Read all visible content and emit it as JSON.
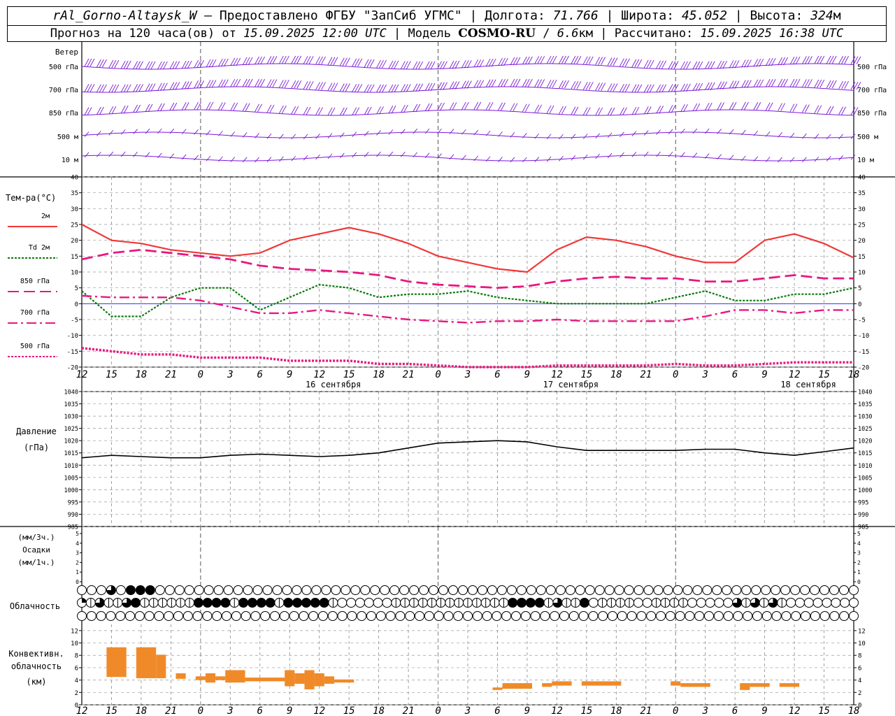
{
  "header": {
    "station": "rAl_Gorno-Altaysk_W",
    "provider": "– Предоставлено ФГБУ \"ЗапСиб УГМС\"",
    "lon_label": "Долгота:",
    "lon": "71.766",
    "lat_label": "Широта:",
    "lat": "45.052",
    "alt_label": "Высота:",
    "alt": "324",
    "alt_unit": "м",
    "forecast_prefix": "Прогноз на 120 часа(ов) от",
    "forecast_start": "15.09.2025 12:00 UTC",
    "model_prefix": "Модель",
    "model": "COSMO-RU",
    "resolution": "6.6",
    "res_unit": "км",
    "computed_label": "Рассчитано:",
    "computed": "15.09.2025 16:38 UTC"
  },
  "colors": {
    "wind": "#7b18d8",
    "t2m": "#f03838",
    "td": "#0a7a0a",
    "t850": "#e8187f",
    "t700": "#e8187f",
    "t500": "#e8187f",
    "zero": "#3030ff",
    "pressure": "#000000",
    "conv": "#f08a28"
  },
  "chart_data": [
    {
      "type": "wind_barbs",
      "panel_label": "Ветер",
      "levels": [
        "500 гПа",
        "700 гПа",
        "850 гПа",
        "500 м",
        "10 м"
      ]
    },
    {
      "type": "line",
      "panel_label": "Тем-ра(°C)",
      "ylim": [
        -20,
        40
      ],
      "yticks": [
        -20,
        -15,
        -10,
        -5,
        0,
        5,
        10,
        15,
        20,
        25,
        30,
        35,
        40
      ],
      "x_hours_from_start": [
        0,
        3,
        6,
        9,
        12,
        15,
        18,
        21,
        24,
        27,
        30,
        33,
        36,
        39,
        42,
        45,
        48,
        51,
        54,
        57,
        60,
        63,
        66,
        69,
        72,
        75,
        78
      ],
      "series": [
        {
          "name": "2м",
          "style": "solid",
          "values": [
            25,
            20,
            19,
            17,
            16,
            15,
            16,
            20,
            22,
            24,
            22,
            19,
            15,
            13,
            11,
            10,
            17,
            21,
            20,
            18,
            15,
            13,
            13,
            20,
            22,
            19,
            14.5
          ]
        },
        {
          "name": "Td 2м",
          "style": "dotted",
          "values": [
            4,
            -4,
            -4,
            2,
            5,
            5,
            -2,
            2,
            6,
            5,
            2,
            3,
            3,
            4,
            2,
            1,
            0,
            0,
            0,
            0,
            2,
            4,
            1,
            1,
            3,
            3,
            5
          ]
        },
        {
          "name": "850 гПа",
          "style": "dash",
          "values": [
            14,
            16,
            17,
            16,
            15,
            14,
            12,
            11,
            10.5,
            10,
            9,
            7,
            6,
            5.5,
            5,
            5.5,
            7,
            8,
            8.5,
            8,
            8,
            7,
            7,
            8,
            9,
            8,
            8
          ]
        },
        {
          "name": "700 гПа",
          "style": "dashdot",
          "values": [
            2.5,
            2,
            2,
            2,
            1,
            -1,
            -3,
            -3,
            -2,
            -3,
            -4,
            -5,
            -5.5,
            -6,
            -5.5,
            -5.5,
            -5,
            -5.5,
            -5.5,
            -5.5,
            -5.5,
            -4,
            -2,
            -2,
            -3,
            -2,
            -2
          ]
        },
        {
          "name": "500 гПа",
          "style": "dotted_thick",
          "values": [
            -14,
            -15,
            -16,
            -16,
            -17,
            -17,
            -17,
            -18,
            -18,
            -18,
            -19,
            -19,
            -19.5,
            -20,
            -20,
            -20,
            -19.5,
            -19.5,
            -19.5,
            -19.5,
            -19,
            -19.5,
            -19.5,
            -19,
            -18.5,
            -18.5,
            -18.5
          ]
        }
      ]
    },
    {
      "type": "line",
      "panel_label": "Давление",
      "unit_label": "(гПа)",
      "ylim": [
        985,
        1040
      ],
      "yticks": [
        985,
        990,
        995,
        1000,
        1005,
        1010,
        1015,
        1020,
        1025,
        1030,
        1035,
        1040
      ],
      "x_hours_from_start": [
        0,
        3,
        6,
        9,
        12,
        15,
        18,
        21,
        24,
        27,
        30,
        33,
        36,
        39,
        42,
        45,
        48,
        51,
        54,
        57,
        60,
        63,
        66,
        69,
        72,
        75,
        78
      ],
      "series": [
        {
          "name": "Давление",
          "values": [
            1013,
            1014,
            1013.5,
            1013,
            1013,
            1014,
            1014.5,
            1014,
            1013.5,
            1014,
            1015,
            1017,
            1019,
            1019.5,
            1020,
            1019.5,
            1017.5,
            1016,
            1016,
            1016,
            1016,
            1016.5,
            1016.5,
            1015,
            1014,
            1015.5,
            1017
          ]
        }
      ]
    },
    {
      "type": "bar",
      "panel_label": "Осадки",
      "unit_3h": "(мм/3ч.)",
      "unit_1h": "(мм/1ч.)",
      "ylim": [
        0,
        5
      ],
      "values": []
    },
    {
      "type": "cloud_cover",
      "panel_label": "Облачность",
      "rows": [
        [
          0,
          0,
          0,
          3,
          0,
          4,
          4,
          4,
          0,
          0,
          0,
          0,
          0,
          0,
          0,
          0,
          0,
          0,
          0,
          0,
          0,
          0,
          0,
          0,
          0,
          0,
          0,
          0,
          0,
          0,
          0,
          0,
          0,
          0,
          0,
          0,
          0,
          0,
          0,
          0,
          0,
          0,
          0,
          0,
          0,
          0,
          0,
          0,
          0,
          0,
          0,
          0,
          0,
          0,
          0,
          0,
          0,
          0,
          0,
          0,
          0,
          0,
          0,
          0,
          0,
          0,
          0,
          0,
          0,
          0,
          0,
          0,
          0,
          0,
          0,
          0,
          0,
          0,
          0,
          0
        ],
        [
          1,
          2,
          3,
          2,
          2,
          3,
          4,
          2,
          2,
          2,
          2,
          2,
          2,
          4,
          4,
          4,
          4,
          2,
          4,
          4,
          4,
          4,
          2,
          4,
          4,
          4,
          4,
          4,
          2,
          0,
          0,
          0,
          0,
          0,
          0,
          2,
          2,
          2,
          2,
          2,
          2,
          2,
          2,
          2,
          2,
          2,
          2,
          2,
          4,
          4,
          4,
          4,
          2,
          3,
          2,
          2,
          4,
          0,
          2,
          2,
          2,
          2,
          0,
          0,
          2,
          2,
          2,
          2,
          0,
          0,
          0,
          0,
          0,
          3,
          2,
          3,
          2,
          3,
          2,
          0,
          0,
          0,
          0,
          0,
          0,
          0,
          0
        ],
        [
          0,
          0,
          0,
          0,
          0,
          0,
          0,
          0,
          0,
          0,
          0,
          0,
          0,
          0,
          0,
          0,
          0,
          0,
          0,
          0,
          0,
          0,
          0,
          0,
          0,
          0,
          0,
          0,
          0,
          0,
          0,
          0,
          0,
          0,
          0,
          0,
          0,
          0,
          0,
          0,
          0,
          0,
          0,
          0,
          0,
          0,
          0,
          0,
          0,
          0,
          0,
          0,
          0,
          0,
          0,
          0,
          0,
          0,
          0,
          0,
          0,
          0,
          0,
          0,
          0,
          0,
          0,
          0,
          0,
          0,
          0,
          0,
          0,
          0,
          0,
          0,
          0,
          0,
          0,
          0,
          0
        ]
      ]
    },
    {
      "type": "bar",
      "panel_label": "Конвективн. облачность (км)",
      "ylim": [
        0,
        13
      ],
      "yticks": [
        0,
        2,
        4,
        6,
        8,
        10,
        12
      ],
      "bars": [
        {
          "h0": 2.5,
          "h1": 4.5,
          "base": 4.5,
          "top": 9.3
        },
        {
          "h0": 5.5,
          "h1": 7.5,
          "base": 4.3,
          "top": 9.3
        },
        {
          "h0": 7.5,
          "h1": 8.5,
          "base": 4.3,
          "top": 8.1
        },
        {
          "h0": 9.5,
          "h1": 10.5,
          "base": 4.2,
          "top": 5.1
        },
        {
          "h0": 11.5,
          "h1": 12.5,
          "base": 4.0,
          "top": 4.6
        },
        {
          "h0": 12.5,
          "h1": 13.5,
          "base": 3.6,
          "top": 5.1
        },
        {
          "h0": 13.5,
          "h1": 14.5,
          "base": 4.0,
          "top": 4.6
        },
        {
          "h0": 14.5,
          "h1": 16.5,
          "base": 3.6,
          "top": 5.6
        },
        {
          "h0": 16.5,
          "h1": 20.5,
          "base": 3.8,
          "top": 4.4
        },
        {
          "h0": 20.5,
          "h1": 21.5,
          "base": 3.0,
          "top": 5.6
        },
        {
          "h0": 21.5,
          "h1": 22.5,
          "base": 3.4,
          "top": 5.1
        },
        {
          "h0": 22.5,
          "h1": 23.5,
          "base": 2.5,
          "top": 5.6
        },
        {
          "h0": 23.5,
          "h1": 24.5,
          "base": 3.0,
          "top": 5.1
        },
        {
          "h0": 24.5,
          "h1": 25.5,
          "base": 3.4,
          "top": 4.6
        },
        {
          "h0": 25.5,
          "h1": 27.5,
          "base": 3.6,
          "top": 4.1
        },
        {
          "h0": 41.5,
          "h1": 42.5,
          "base": 2.4,
          "top": 2.8
        },
        {
          "h0": 42.5,
          "h1": 45.5,
          "base": 2.6,
          "top": 3.5
        },
        {
          "h0": 46.5,
          "h1": 47.5,
          "base": 2.9,
          "top": 3.5
        },
        {
          "h0": 47.5,
          "h1": 49.5,
          "base": 3.1,
          "top": 3.8
        },
        {
          "h0": 50.5,
          "h1": 54.5,
          "base": 3.1,
          "top": 3.8
        },
        {
          "h0": 59.5,
          "h1": 60.5,
          "base": 3.1,
          "top": 3.8
        },
        {
          "h0": 60.5,
          "h1": 63.5,
          "base": 2.9,
          "top": 3.5
        },
        {
          "h0": 66.5,
          "h1": 67.5,
          "base": 2.4,
          "top": 3.5
        },
        {
          "h0": 67.5,
          "h1": 69.5,
          "base": 2.9,
          "top": 3.5
        },
        {
          "h0": 70.5,
          "h1": 72.5,
          "base": 2.9,
          "top": 3.5
        }
      ]
    }
  ],
  "xaxis": {
    "hour_labels": [
      "12",
      "15",
      "18",
      "21",
      "0",
      "3",
      "6",
      "9",
      "12",
      "15",
      "18",
      "21",
      "0",
      "3",
      "6",
      "9",
      "12",
      "15",
      "18",
      "21",
      "0",
      "3",
      "6",
      "9",
      "12",
      "15",
      "18"
    ],
    "dates": [
      {
        "label": "16 сентября",
        "at_hour": 24
      },
      {
        "label": "17 сентября",
        "at_hour": 48
      },
      {
        "label": "18 сентября",
        "at_hour": 72
      }
    ]
  }
}
